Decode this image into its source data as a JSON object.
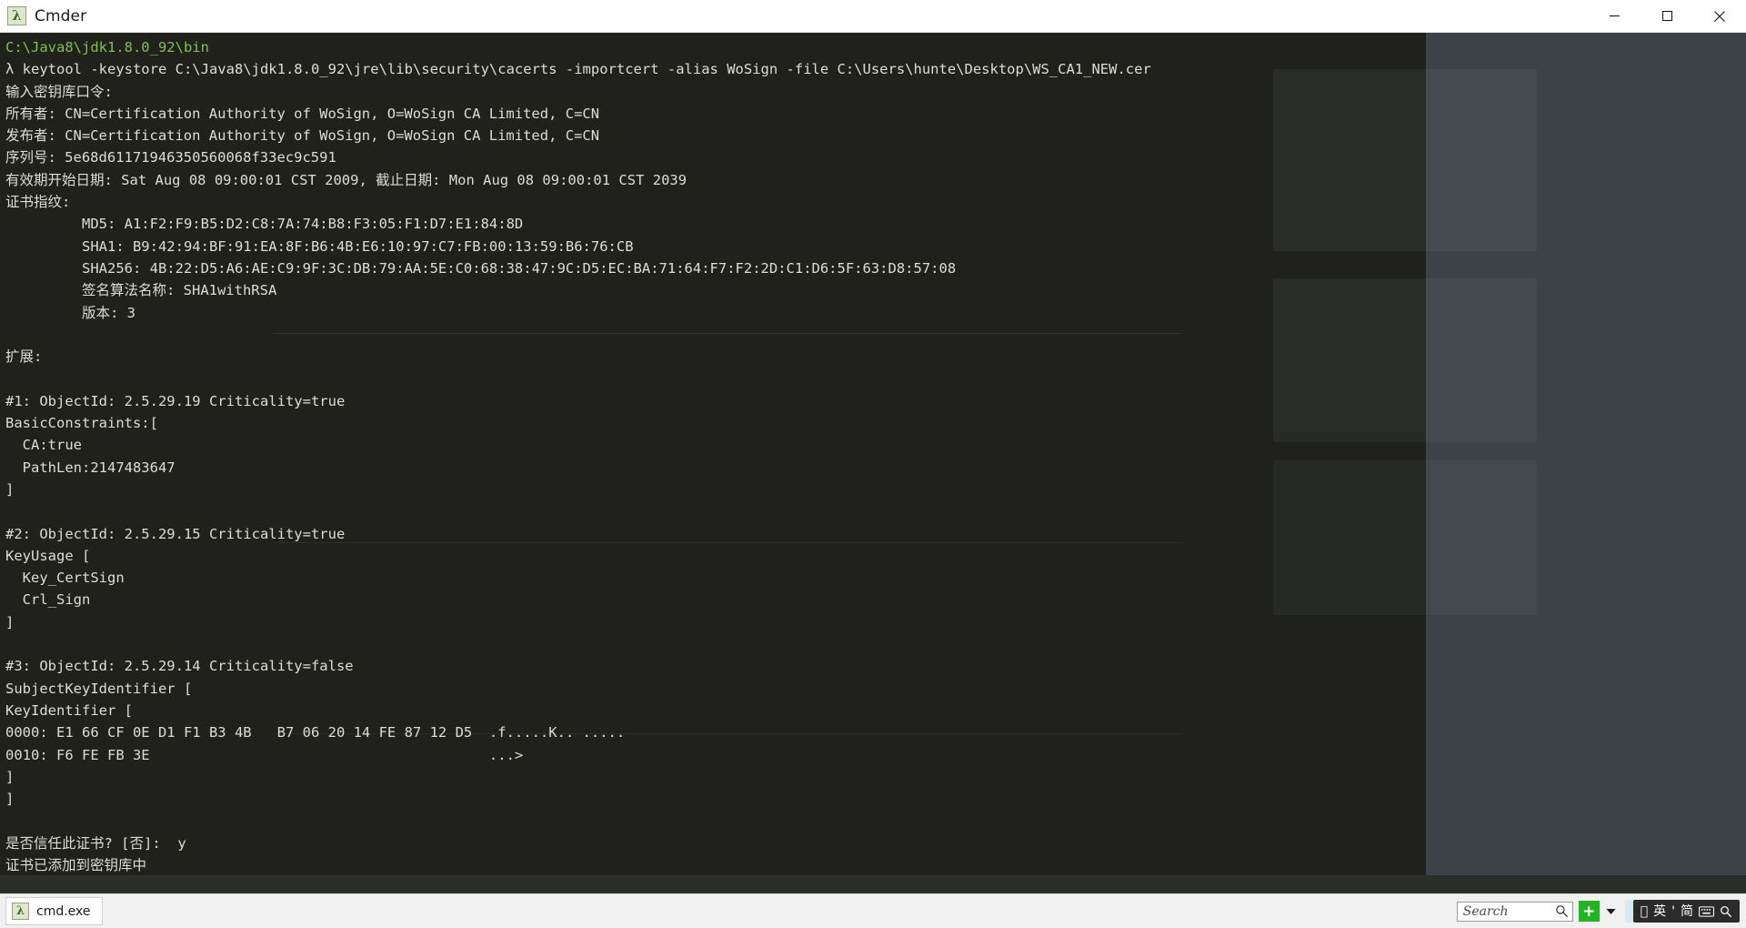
{
  "window": {
    "title": "Cmder",
    "icon": "lambda-icon",
    "minimize_label": "Minimize",
    "maximize_label": "Maximize",
    "close_label": "Close"
  },
  "terminal": {
    "colors": {
      "background": "#20211c",
      "foreground": "#d5d3cc",
      "path_green": "#7ec24a"
    },
    "lines": [
      {
        "text": "C:\\Java8\\jdk1.8.0_92\\bin",
        "color": "green"
      },
      {
        "text": "λ keytool -keystore C:\\Java8\\jdk1.8.0_92\\jre\\lib\\security\\cacerts -importcert -alias WoSign -file C:\\Users\\hunte\\Desktop\\WS_CA1_NEW.cer",
        "color": "white"
      },
      {
        "text": "输入密钥库口令:",
        "color": "white"
      },
      {
        "text": "所有者: CN=Certification Authority of WoSign, O=WoSign CA Limited, C=CN",
        "color": "white"
      },
      {
        "text": "发布者: CN=Certification Authority of WoSign, O=WoSign CA Limited, C=CN",
        "color": "white"
      },
      {
        "text": "序列号: 5e68d61171946350560068f33ec9c591",
        "color": "white"
      },
      {
        "text": "有效期开始日期: Sat Aug 08 09:00:01 CST 2009, 截止日期: Mon Aug 08 09:00:01 CST 2039",
        "color": "white"
      },
      {
        "text": "证书指纹:",
        "color": "white"
      },
      {
        "text": "         MD5: A1:F2:F9:B5:D2:C8:7A:74:B8:F3:05:F1:D7:E1:84:8D",
        "color": "white"
      },
      {
        "text": "         SHA1: B9:42:94:BF:91:EA:8F:B6:4B:E6:10:97:C7:FB:00:13:59:B6:76:CB",
        "color": "white"
      },
      {
        "text": "         SHA256: 4B:22:D5:A6:AE:C9:9F:3C:DB:79:AA:5E:C0:68:38:47:9C:D5:EC:BA:71:64:F7:F2:2D:C1:D6:5F:63:D8:57:08",
        "color": "white"
      },
      {
        "text": "         签名算法名称: SHA1withRSA",
        "color": "white"
      },
      {
        "text": "         版本: 3",
        "color": "white"
      },
      {
        "text": "",
        "color": "white"
      },
      {
        "text": "扩展: ",
        "color": "white"
      },
      {
        "text": "",
        "color": "white"
      },
      {
        "text": "#1: ObjectId: 2.5.29.19 Criticality=true",
        "color": "white"
      },
      {
        "text": "BasicConstraints:[",
        "color": "white"
      },
      {
        "text": "  CA:true",
        "color": "white"
      },
      {
        "text": "  PathLen:2147483647",
        "color": "white"
      },
      {
        "text": "]",
        "color": "white"
      },
      {
        "text": "",
        "color": "white"
      },
      {
        "text": "#2: ObjectId: 2.5.29.15 Criticality=true",
        "color": "white"
      },
      {
        "text": "KeyUsage [",
        "color": "white"
      },
      {
        "text": "  Key_CertSign",
        "color": "white"
      },
      {
        "text": "  Crl_Sign",
        "color": "white"
      },
      {
        "text": "]",
        "color": "white"
      },
      {
        "text": "",
        "color": "white"
      },
      {
        "text": "#3: ObjectId: 2.5.29.14 Criticality=false",
        "color": "white"
      },
      {
        "text": "SubjectKeyIdentifier [",
        "color": "white"
      },
      {
        "text": "KeyIdentifier [",
        "color": "white"
      },
      {
        "text": "0000: E1 66 CF 0E D1 F1 B3 4B   B7 06 20 14 FE 87 12 D5  .f.....K.. .....",
        "color": "white"
      },
      {
        "text": "0010: F6 FE FB 3E                                        ...>",
        "color": "white"
      },
      {
        "text": "]",
        "color": "white"
      },
      {
        "text": "]",
        "color": "white"
      },
      {
        "text": "",
        "color": "white"
      },
      {
        "text": "是否信任此证书? [否]:  y",
        "color": "white"
      },
      {
        "text": "证书已添加到密钥库中",
        "color": "white"
      }
    ]
  },
  "taskbar": {
    "items": [
      {
        "label": "cmd.exe",
        "icon": "lambda-icon"
      }
    ],
    "search": {
      "placeholder": "Search",
      "value": "Search",
      "icon": "search-icon"
    },
    "tray": {
      "add_label": "+",
      "caret": "▼",
      "ime": {
        "logo": "apple-icon",
        "language": "英",
        "punctuation": "'",
        "script": "简",
        "keyboard": "keyboard-icon",
        "search": "search-icon"
      }
    }
  }
}
